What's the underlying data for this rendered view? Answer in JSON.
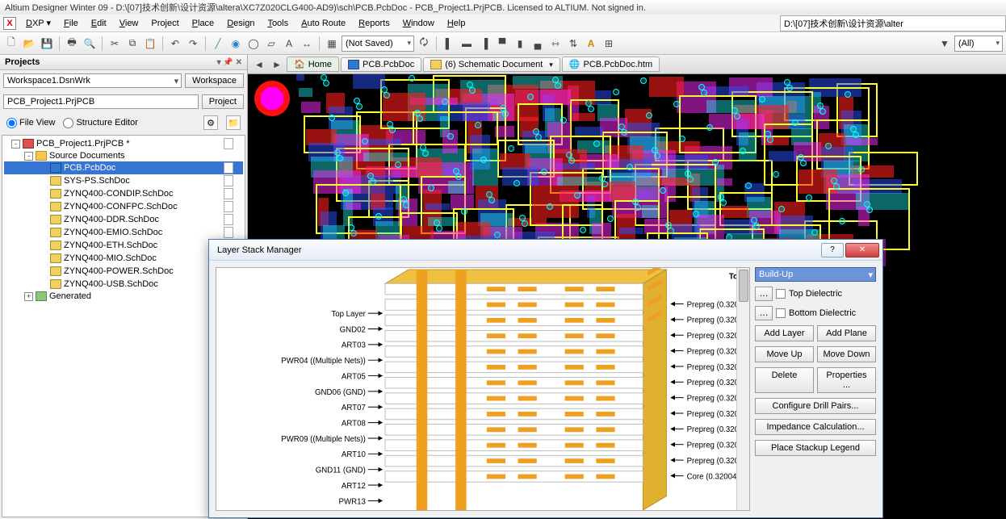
{
  "titlebar": "Altium Designer Winter 09 - D:\\[07]技术创新\\设计资源\\altera\\XC7Z020CLG400-AD9)\\sch\\PCB.PcbDoc - PCB_Project1.PrjPCB. Licensed to ALTIUM. Not signed in.",
  "menu": {
    "dxp": "DXP",
    "file": "File",
    "edit": "Edit",
    "view": "View",
    "project": "Project",
    "place": "Place",
    "design": "Design",
    "tools": "Tools",
    "autoroute": "Auto Route",
    "reports": "Reports",
    "window": "Window",
    "help": "Help",
    "path": "D:\\[07]技术创新\\设计资源\\alter"
  },
  "toolbar": {
    "notsaved": "(Not Saved)",
    "filter_all": "(All)"
  },
  "projects_panel": {
    "title": "Projects",
    "workspace_combo": "Workspace1.DsnWrk",
    "workspace_btn": "Workspace",
    "project_input": "PCB_Project1.PrjPCB",
    "project_btn": "Project",
    "radio_file": "File View",
    "radio_struct": "Structure Editor"
  },
  "tree": [
    {
      "ind": 0,
      "exp": "-",
      "ico": "proj",
      "label": "PCB_Project1.PrjPCB *",
      "doc": true
    },
    {
      "ind": 1,
      "exp": "-",
      "ico": "folder",
      "label": "Source Documents"
    },
    {
      "ind": 2,
      "ico": "pcb",
      "label": "PCB.PcbDoc",
      "sel": true,
      "doc": true
    },
    {
      "ind": 2,
      "ico": "sch",
      "label": "SYS-PS.SchDoc",
      "doc": true
    },
    {
      "ind": 2,
      "ico": "sch",
      "label": "ZYNQ400-CONDIP.SchDoc",
      "doc": true
    },
    {
      "ind": 2,
      "ico": "sch",
      "label": "ZYNQ400-CONFPC.SchDoc",
      "doc": true
    },
    {
      "ind": 2,
      "ico": "sch",
      "label": "ZYNQ400-DDR.SchDoc",
      "doc": true
    },
    {
      "ind": 2,
      "ico": "sch",
      "label": "ZYNQ400-EMIO.SchDoc",
      "doc": true
    },
    {
      "ind": 2,
      "ico": "sch",
      "label": "ZYNQ400-ETH.SchDoc",
      "doc": true
    },
    {
      "ind": 2,
      "ico": "sch",
      "label": "ZYNQ400-MIO.SchDoc",
      "doc": true
    },
    {
      "ind": 2,
      "ico": "sch",
      "label": "ZYNQ400-POWER.SchDoc",
      "doc": true
    },
    {
      "ind": 2,
      "ico": "sch",
      "label": "ZYNQ400-USB.SchDoc",
      "doc": true
    },
    {
      "ind": 1,
      "exp": "+",
      "ico": "gen",
      "label": "Generated"
    }
  ],
  "doctabs": {
    "home": "Home",
    "pcb": "PCB.PcbDoc",
    "sch": "(6) Schematic Document",
    "htm": "PCB.PcbDoc.htm"
  },
  "dialog": {
    "title": "Layer Stack Manager",
    "total": "Total Height",
    "layers_left": [
      "Top Layer",
      "GND02",
      "ART03",
      "PWR04 ((Multiple Nets))",
      "ART05",
      "GND06 (GND)",
      "ART07",
      "ART08",
      "PWR09 ((Multiple Nets))",
      "ART10",
      "GND11 (GND)",
      "ART12",
      "PWR13"
    ],
    "layers_right": [
      "Prepreg (0.320",
      "Prepreg (0.320",
      "Prepreg (0.320",
      "Prepreg (0.320",
      "Prepreg (0.320",
      "Prepreg (0.320",
      "Prepreg (0.320",
      "Prepreg (0.320",
      "Prepreg (0.320",
      "Prepreg (0.320",
      "Prepreg (0.320",
      "Core (0.32004"
    ],
    "combo": "Build-Up",
    "top_di": "Top Dielectric",
    "bot_di": "Bottom Dielectric",
    "add_layer": "Add Layer",
    "add_plane": "Add Plane",
    "move_up": "Move Up",
    "move_down": "Move Down",
    "delete": "Delete",
    "properties": "Properties ...",
    "drill": "Configure Drill Pairs...",
    "impedance": "Impedance Calculation...",
    "legend": "Place Stackup Legend"
  }
}
